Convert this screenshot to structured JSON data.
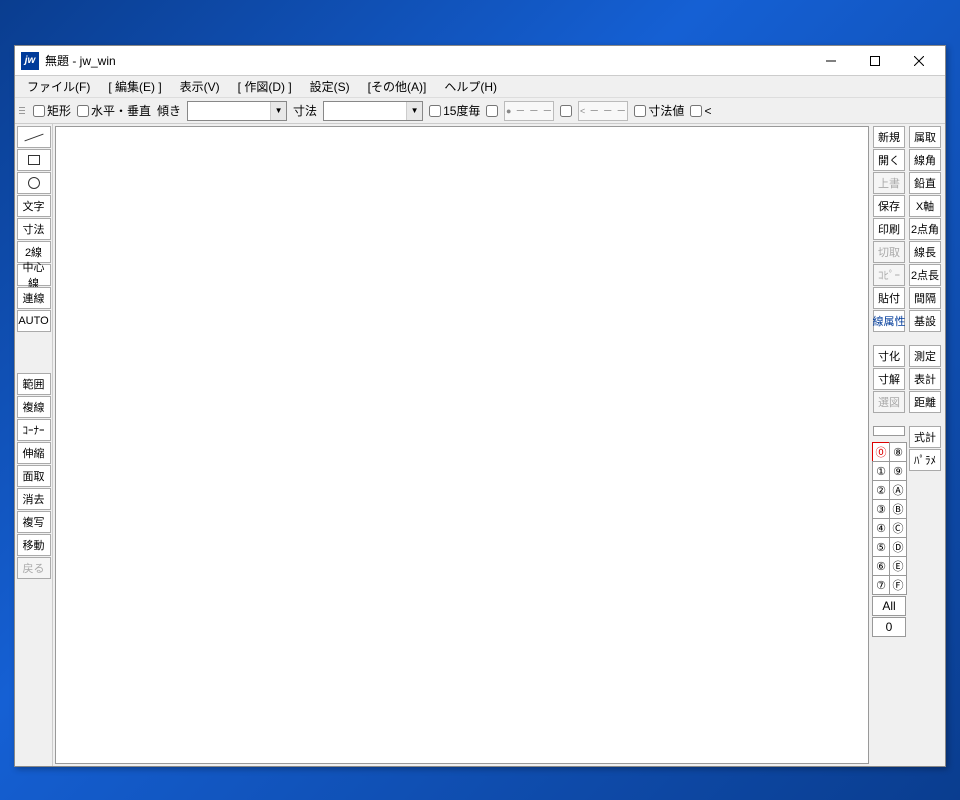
{
  "window": {
    "title": "無題 - jw_win",
    "icon_text": "jw"
  },
  "menubar": [
    "ファイル(F)",
    "[ 編集(E) ]",
    "表示(V)",
    "[ 作図(D) ]",
    "設定(S)",
    "[その他(A)]",
    "ヘルプ(H)"
  ],
  "options": {
    "rect": "矩形",
    "hv": "水平・垂直",
    "angle": "傾き",
    "dimension": "寸法",
    "every15": "15度毎",
    "dimvalue": "寸法値",
    "lt": "<",
    "pat1": "● ー ー ー",
    "pat2": "< ー ー ー"
  },
  "left_tools_1": [
    {
      "id": "line",
      "type": "icon-line"
    },
    {
      "id": "rect",
      "type": "icon-box"
    },
    {
      "id": "circle",
      "type": "icon-circle"
    },
    {
      "id": "text",
      "label": "文字"
    },
    {
      "id": "dim",
      "label": "寸法"
    },
    {
      "id": "line2",
      "label": "2線"
    },
    {
      "id": "center",
      "label": "中心線"
    },
    {
      "id": "renline",
      "label": "連線"
    },
    {
      "id": "auto",
      "label": "AUTO"
    }
  ],
  "left_tools_2": [
    {
      "id": "range",
      "label": "範囲"
    },
    {
      "id": "multi",
      "label": "複線"
    },
    {
      "id": "corner",
      "label": "ｺｰﾅｰ"
    },
    {
      "id": "stretch",
      "label": "伸縮"
    },
    {
      "id": "chamfer",
      "label": "面取"
    },
    {
      "id": "erase",
      "label": "消去"
    },
    {
      "id": "copy",
      "label": "複写"
    },
    {
      "id": "move",
      "label": "移動"
    },
    {
      "id": "back",
      "label": "戻る",
      "disabled": true
    }
  ],
  "right_col_a": [
    {
      "id": "new",
      "label": "新規"
    },
    {
      "id": "open",
      "label": "開く"
    },
    {
      "id": "overwrite",
      "label": "上書",
      "disabled": true
    },
    {
      "id": "save",
      "label": "保存"
    },
    {
      "id": "print",
      "label": "印刷"
    },
    {
      "id": "cut",
      "label": "切取",
      "disabled": true
    },
    {
      "id": "copycmd",
      "label": "ｺﾋﾟｰ",
      "disabled": true
    },
    {
      "id": "paste",
      "label": "貼付"
    },
    {
      "id": "lineprop",
      "label": "線属性",
      "blue": true
    }
  ],
  "right_col_b": [
    {
      "id": "attrget",
      "label": "属取"
    },
    {
      "id": "lineang",
      "label": "線角"
    },
    {
      "id": "plumb",
      "label": "鉛直"
    },
    {
      "id": "xaxis",
      "label": "X軸"
    },
    {
      "id": "ang2pt",
      "label": "2点角"
    },
    {
      "id": "linelen",
      "label": "線長"
    },
    {
      "id": "len2pt",
      "label": "2点長"
    },
    {
      "id": "interval",
      "label": "間隔"
    },
    {
      "id": "baseset",
      "label": "基設"
    }
  ],
  "right_col_a2": [
    {
      "id": "dimka",
      "label": "寸化"
    },
    {
      "id": "dimkai",
      "label": "寸解"
    },
    {
      "id": "selzu",
      "label": "選図",
      "disabled": true
    }
  ],
  "right_col_b2": [
    {
      "id": "measure",
      "label": "測定"
    },
    {
      "id": "table",
      "label": "表計"
    },
    {
      "id": "distance",
      "label": "距離"
    }
  ],
  "right_col_b3": [
    {
      "id": "formula",
      "label": "式計"
    },
    {
      "id": "param",
      "label": "ﾊﾟﾗﾒ"
    }
  ],
  "layers_left": [
    "⓪",
    "①",
    "②",
    "③",
    "④",
    "⑤",
    "⑥",
    "⑦"
  ],
  "layers_right": [
    "⑧",
    "⑨",
    "Ⓐ",
    "Ⓑ",
    "Ⓒ",
    "Ⓓ",
    "Ⓔ",
    "Ⓕ"
  ],
  "layer_all": "All",
  "layer_zero": "0"
}
